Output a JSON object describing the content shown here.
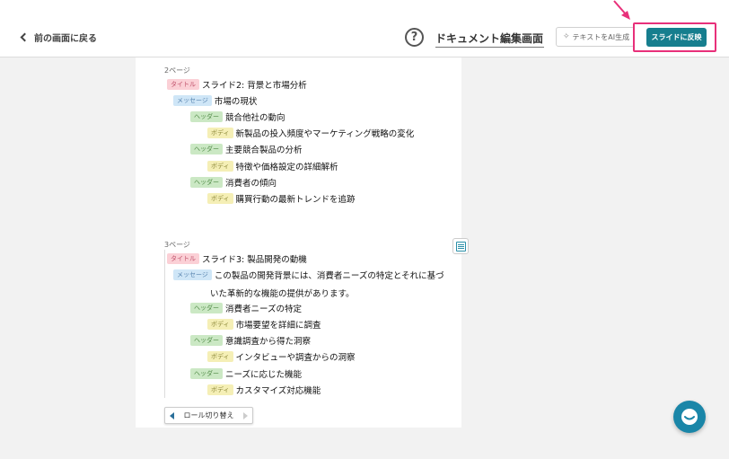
{
  "header": {
    "back_label": "前の画面に戻る",
    "help_symbol": "?",
    "mode_select": "ドキュメント編集画面",
    "ai_button": "テキストをAI生成",
    "reflect_button": "スライドに反映",
    "highlight_color": "#e8307a",
    "accent_color": "#167e8e"
  },
  "tags": {
    "title": "タイトル",
    "message": "メッセージ",
    "header": "ヘッダー",
    "body": "ボディ"
  },
  "pages": [
    {
      "label": "2ページ",
      "title": "スライド2: 背景と市場分析",
      "message": "市場の現状",
      "header1": "競合他社の動向",
      "body1": "新製品の投入頻度やマーケティング戦略の変化",
      "header2": "主要競合製品の分析",
      "body2": "特徴や価格設定の詳細解析",
      "header3": "消費者の傾向",
      "body3": "購買行動の最新トレンドを追跡"
    },
    {
      "label": "3ページ",
      "title": "スライド3: 製品開発の動機",
      "message_line1": "この製品の開発背景には、消費者ニーズの特定とそれに基づ",
      "message_line2": "いた革新的な機能の提供があります。",
      "header1": "消費者ニーズの特定",
      "body1": "市場要望を詳細に調査",
      "header2": "意識調査から得た洞察",
      "body2": "インタビューや調査からの洞察",
      "header3": "ニーズに応じた機能",
      "body3": "カスタマイズ対応機能"
    }
  ],
  "role_toggle": "ロール切り替え"
}
